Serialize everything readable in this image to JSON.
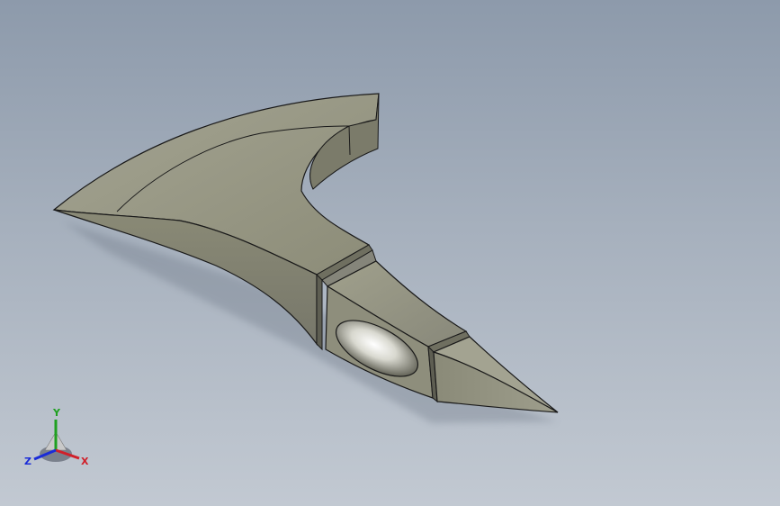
{
  "viewport": {
    "background_top": "#8d9aab",
    "background_bottom": "#c2c9d2"
  },
  "model": {
    "face_color": "#9a9a86",
    "dark_face_color": "#6f6f60",
    "edge_color": "#1a1a1a"
  },
  "triad": {
    "x_label": "X",
    "y_label": "Y",
    "z_label": "Z",
    "x_color": "#d0202a",
    "y_color": "#1fa020",
    "z_color": "#1a2cd8"
  }
}
